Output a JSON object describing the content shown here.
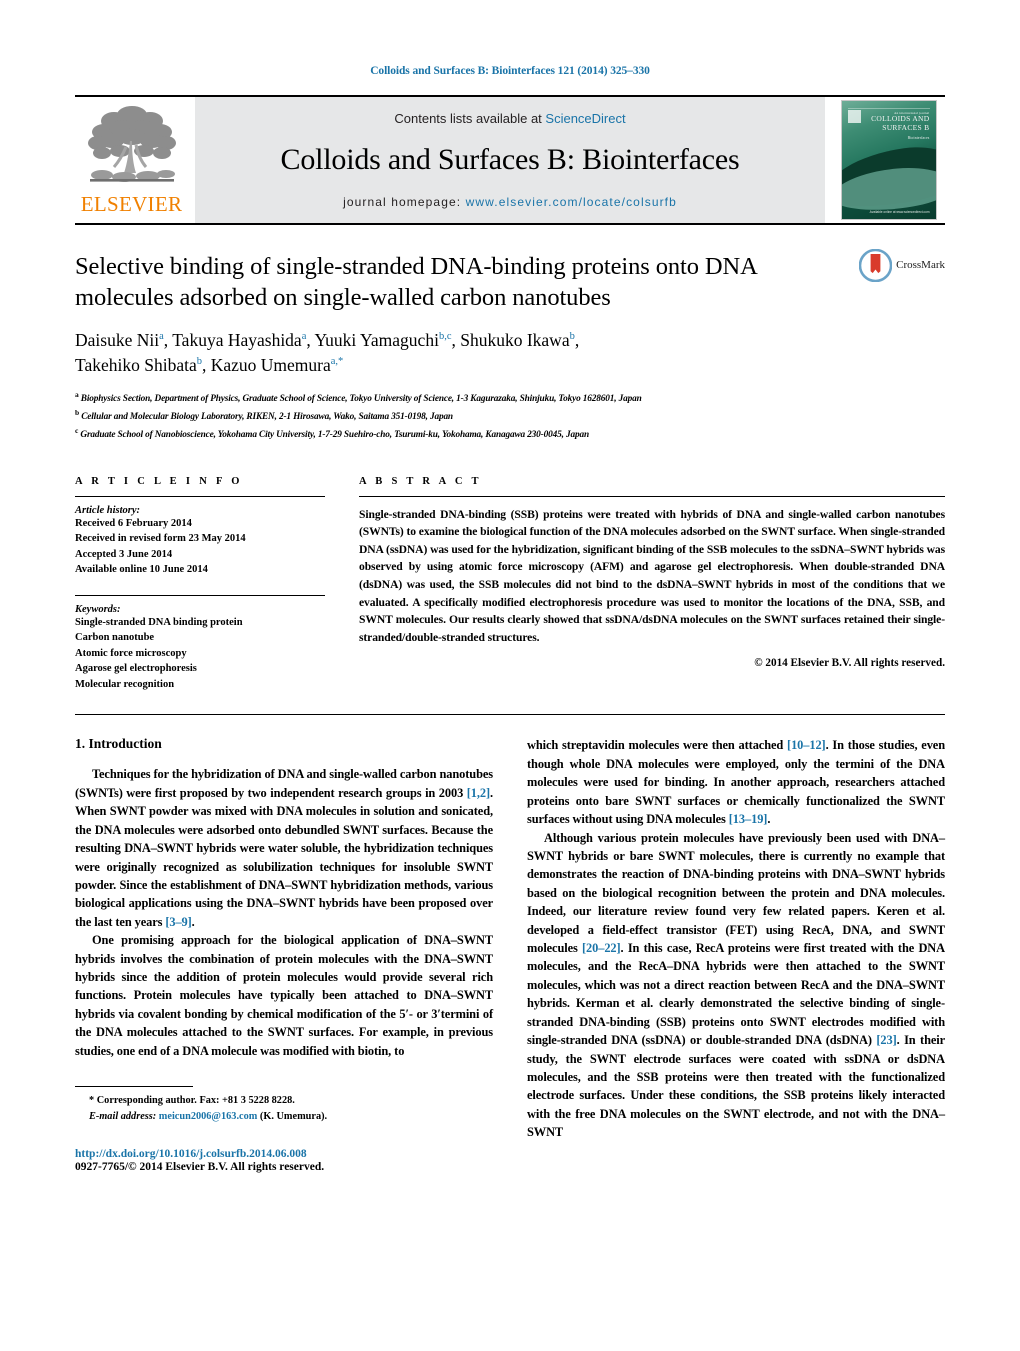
{
  "running_head": "Colloids and Surfaces B: Biointerfaces 121 (2014) 325–330",
  "masthead": {
    "publisher": "ELSEVIER",
    "contents_prefix": "Contents lists available at ",
    "contents_link": "ScienceDirect",
    "journal_name": "Colloids and Surfaces B: Biointerfaces",
    "homepage_prefix": "journal homepage: ",
    "homepage_url": "www.elsevier.com/locate/colsurfb",
    "cover": {
      "line1": "An international journal",
      "line2": "COLLOIDS AND SURFACES B",
      "line3": "Biointerfaces",
      "bottom": "Available online at www.sciencedirect.com"
    }
  },
  "crossmark": {
    "label": "CrossMark"
  },
  "article": {
    "title": "Selective binding of single-stranded DNA-binding proteins onto DNA molecules adsorbed on single-walled carbon nanotubes",
    "authors_line1": "Daisuke Nii",
    "authors": [
      {
        "name": "Daisuke Nii",
        "sup": "a"
      },
      {
        "name": "Takuya Hayashida",
        "sup": "a"
      },
      {
        "name": "Yuuki Yamaguchi",
        "sup": "b,c"
      },
      {
        "name": "Shukuko Ikawa",
        "sup": "b"
      },
      {
        "name": "Takehiko Shibata",
        "sup": "b"
      },
      {
        "name": "Kazuo Umemura",
        "sup": "a,*"
      }
    ],
    "affiliations": [
      {
        "sup": "a",
        "text": "Biophysics Section, Department of Physics, Graduate School of Science, Tokyo University of Science, 1-3 Kagurazaka, Shinjuku, Tokyo 1628601, Japan"
      },
      {
        "sup": "b",
        "text": "Cellular and Molecular Biology Laboratory, RIKEN, 2-1 Hirosawa, Wako, Saitama 351-0198, Japan"
      },
      {
        "sup": "c",
        "text": "Graduate School of Nanobioscience, Yokohama City University, 1-7-29 Suehiro-cho, Tsurumi-ku, Yokohama, Kanagawa 230-0045, Japan"
      }
    ]
  },
  "article_info": {
    "heading": "A R T I C L E    I N F O",
    "history_label": "Article history:",
    "history": [
      "Received 6 February 2014",
      "Received in revised form 23 May 2014",
      "Accepted 3 June 2014",
      "Available online 10 June 2014"
    ],
    "keywords_label": "Keywords:",
    "keywords": [
      "Single-stranded DNA binding protein",
      "Carbon nanotube",
      "Atomic force microscopy",
      "Agarose gel electrophoresis",
      "Molecular recognition"
    ]
  },
  "abstract": {
    "heading": "A B S T R A C T",
    "text": "Single-stranded DNA-binding (SSB) proteins were treated with hybrids of DNA and single-walled carbon nanotubes (SWNTs) to examine the biological function of the DNA molecules adsorbed on the SWNT surface. When single-stranded DNA (ssDNA) was used for the hybridization, significant binding of the SSB molecules to the ssDNA–SWNT hybrids was observed by using atomic force microscopy (AFM) and agarose gel electrophoresis. When double-stranded DNA (dsDNA) was used, the SSB molecules did not bind to the dsDNA–SWNT hybrids in most of the conditions that we evaluated. A specifically modified electrophoresis procedure was used to monitor the locations of the DNA, SSB, and SWNT molecules. Our results clearly showed that ssDNA/dsDNA molecules on the SWNT surfaces retained their single-stranded/double-stranded structures.",
    "copyright": "© 2014 Elsevier B.V. All rights reserved."
  },
  "introduction": {
    "heading": "1.  Introduction",
    "left_paragraphs": [
      {
        "parts": [
          {
            "t": "Techniques for the hybridization of DNA and single-walled carbon nanotubes (SWNTs) were first proposed by two independent research groups in 2003 ",
            "k": "plain"
          },
          {
            "t": "[1,2]",
            "k": "ref"
          },
          {
            "t": ". When SWNT powder was mixed with DNA molecules in solution and sonicated, the DNA molecules were adsorbed onto debundled SWNT surfaces. Because the resulting DNA–SWNT hybrids were water soluble, the hybridization techniques were originally recognized as solubilization techniques for insoluble SWNT powder. Since the establishment of DNA–SWNT hybridization methods, various biological applications using the DNA–SWNT hybrids have been proposed over the last ten years ",
            "k": "plain"
          },
          {
            "t": "[3–9]",
            "k": "ref"
          },
          {
            "t": ".",
            "k": "plain"
          }
        ]
      },
      {
        "parts": [
          {
            "t": "One promising approach for the biological application of DNA–SWNT hybrids involves the combination of protein molecules with the DNA–SWNT hybrids since the addition of protein molecules would provide several rich functions. Protein molecules have typically been attached to DNA–SWNT hybrids via covalent bonding by chemical modification of the 5′- or 3′termini of the DNA molecules attached to the SWNT surfaces. For example, in previous studies, one end of a DNA molecule was modified with biotin, to",
            "k": "plain"
          }
        ]
      }
    ],
    "right_paragraphs": [
      {
        "parts": [
          {
            "t": "which streptavidin molecules were then attached ",
            "k": "plain"
          },
          {
            "t": "[10–12]",
            "k": "ref"
          },
          {
            "t": ". In those studies, even though whole DNA molecules were employed, only the termini of the DNA molecules were used for binding. In another approach, researchers attached proteins onto bare SWNT surfaces or chemically functionalized the SWNT surfaces without using DNA molecules ",
            "k": "plain"
          },
          {
            "t": "[13–19]",
            "k": "ref"
          },
          {
            "t": ".",
            "k": "plain"
          }
        ]
      },
      {
        "parts": [
          {
            "t": "Although various protein molecules have previously been used with DNA–SWNT hybrids or bare SWNT molecules, there is currently no example that demonstrates the reaction of DNA-binding proteins with DNA–SWNT hybrids based on the biological recognition between the protein and DNA molecules. Indeed, our literature review found very few related papers. Keren et al. developed a field-effect transistor (FET) using RecA, DNA, and SWNT molecules ",
            "k": "plain"
          },
          {
            "t": "[20–22]",
            "k": "ref"
          },
          {
            "t": ". In this case, RecA proteins were first treated with the DNA molecules, and the RecA–DNA hybrids were then attached to the SWNT molecules, which was not a direct reaction between RecA and the DNA–SWNT hybrids. Kerman et al. clearly demonstrated the selective binding of single-stranded DNA-binding (SSB) proteins onto SWNT electrodes modified with single-stranded DNA (ssDNA) or double-stranded DNA (dsDNA) ",
            "k": "plain"
          },
          {
            "t": "[23]",
            "k": "ref"
          },
          {
            "t": ". In their study, the SWNT electrode surfaces were coated with ssDNA or dsDNA molecules, and the SSB proteins were then treated with the functionalized electrode surfaces. Under these conditions, the SSB proteins likely interacted with the free DNA molecules on the SWNT electrode, and not with the DNA–SWNT",
            "k": "plain"
          }
        ]
      }
    ]
  },
  "footnote": {
    "marker": "*",
    "corresponding": "Corresponding author. Fax: +81 3 5228 8228.",
    "email_label": "E-mail address:",
    "email": "meicun2006@163.com",
    "email_suffix": "(K. Umemura)."
  },
  "footer": {
    "doi": "http://dx.doi.org/10.1016/j.colsurfb.2014.06.008",
    "issn_line": "0927-7765/© 2014 Elsevier B.V. All rights reserved."
  },
  "colors": {
    "link": "#1a74a8",
    "elsevier_orange": "#f08000",
    "banner_gray": "#e6e7e8"
  }
}
